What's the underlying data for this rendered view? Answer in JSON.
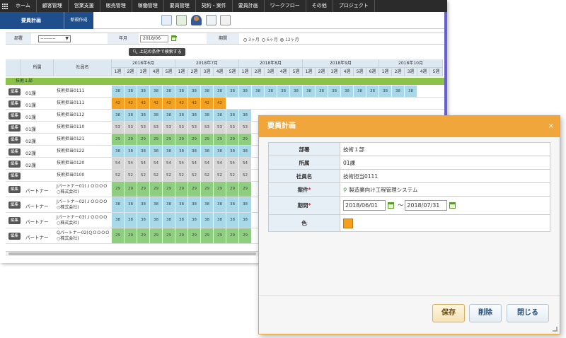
{
  "menu": {
    "items": [
      "ホーム",
      "顧客管理",
      "営業支援",
      "販売管理",
      "稼働管理",
      "要員管理",
      "契約・案件",
      "要員計画",
      "ワークフロー",
      "その他",
      "プロジェクト"
    ]
  },
  "subbar": {
    "active_tab": "要員計画",
    "new_tab": "新規作成"
  },
  "filter": {
    "dept_label": "部署",
    "dept_value": "----------",
    "month_label": "年月",
    "month_value": "2018/06",
    "period_label": "期間",
    "period_options": [
      "3ヶ月",
      "6ヶ月",
      "12ヶ月"
    ],
    "period_selected": "12ヶ月",
    "search_button": "上記の条件で検索する"
  },
  "grid": {
    "col_shozoku": "所属",
    "col_employee": "社員名",
    "months": [
      "2018年6月",
      "2018年7月",
      "2018年8月",
      "2018年9月",
      "2018年10月"
    ],
    "weeks": [
      "1週",
      "2週",
      "3週",
      "4週",
      "5週"
    ],
    "weeks_sep": [
      "1週",
      "2週",
      "3週",
      "4週",
      "5週",
      "6週"
    ],
    "group_label": "技術１部",
    "edit_label": "編集",
    "rows": [
      {
        "shozoku": "01課",
        "name": "技術担当0111",
        "value": "38",
        "color": "#a9d9e8",
        "cells": 24
      },
      {
        "shozoku": "01課",
        "name": "技術担当0111",
        "value": "42",
        "color": "#f2a01e",
        "cells": 9
      },
      {
        "shozoku": "01課",
        "name": "技術担当0112",
        "value": "38",
        "color": "#a9d9e8",
        "cells": 11
      },
      {
        "shozoku": "01課",
        "name": "技術担当0110",
        "value": "53",
        "color": "#d6d6d6",
        "cells": 11
      },
      {
        "shozoku": "02課",
        "name": "技術担当0121",
        "value": "29",
        "color": "#8fce80",
        "cells": 11
      },
      {
        "shozoku": "02課",
        "name": "技術担当0122",
        "value": "38",
        "color": "#a9d9e8",
        "cells": 11
      },
      {
        "shozoku": "02課",
        "name": "技術担当0120",
        "value": "54",
        "color": "#d6d6d6",
        "cells": 11
      },
      {
        "shozoku": "",
        "name": "技術担当0100",
        "value": "52",
        "color": "#d6d6d6",
        "cells": 11
      },
      {
        "shozoku": "パートナー",
        "name": "Jパートナー01(ＪＯＯＯＯ○株式会社)",
        "value": "29",
        "color": "#8fce80",
        "cells": 11
      },
      {
        "shozoku": "パートナー",
        "name": "Jパートナー02(ＪＯＯＯＯ○株式会社)",
        "value": "38",
        "color": "#a9d9e8",
        "cells": 11
      },
      {
        "shozoku": "パートナー",
        "name": "Jパートナー03(ＪＯＯＯＯ○株式会社)",
        "value": "38",
        "color": "#a9d9e8",
        "cells": 11
      },
      {
        "shozoku": "パートナー",
        "name": "Qパートナー02(ＱＯＯＯＯ○株式会社)",
        "value": "29",
        "color": "#8fce80",
        "cells": 11
      }
    ]
  },
  "dialog": {
    "title": "要員計画",
    "close": "×",
    "dept_label": "部署",
    "dept_value": "技術１部",
    "shozoku_label": "所属",
    "shozoku_value": "01課",
    "emp_label": "社員名",
    "emp_value": "技術担当0111",
    "project_label": "案件",
    "project_value": "製造業向け工程管理システム",
    "period_label": "期間",
    "date_from": "2018/06/01",
    "date_sep": "～",
    "date_to": "2018/07/31",
    "color_label": "色",
    "required_mark": "*",
    "color_value": "#f2a01e",
    "save_button": "保存",
    "delete_button": "削除",
    "close_button": "閉じる"
  }
}
